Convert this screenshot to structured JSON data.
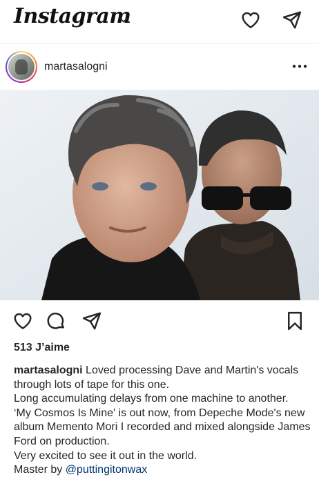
{
  "app": {
    "logo_text": "Instagram"
  },
  "post": {
    "username": "martasalogni",
    "likes_text": "513 J’aime",
    "caption": {
      "username": "martasalogni",
      "line1": "Loved processing Dave and Martin's vocals through lots of tape for this one.",
      "line2": "Long accumulating delays from one machine to another.",
      "line3": "‘My Cosmos Is Mine' is out now, from Depeche Mode's new album Memento Mori I recorded and mixed alongside James Ford on production.",
      "line4": "Very excited to see it out in the world.",
      "line5_prefix": "Master by ",
      "mention": "@puttingitonwax"
    }
  },
  "icons": {
    "logo_chevron": "chevron-down-icon",
    "top_heart": "heart-icon",
    "top_send": "paper-plane-icon",
    "more": "more-dots-icon",
    "like": "heart-icon",
    "comment": "comment-bubble-icon",
    "share": "paper-plane-icon",
    "save": "bookmark-icon"
  }
}
